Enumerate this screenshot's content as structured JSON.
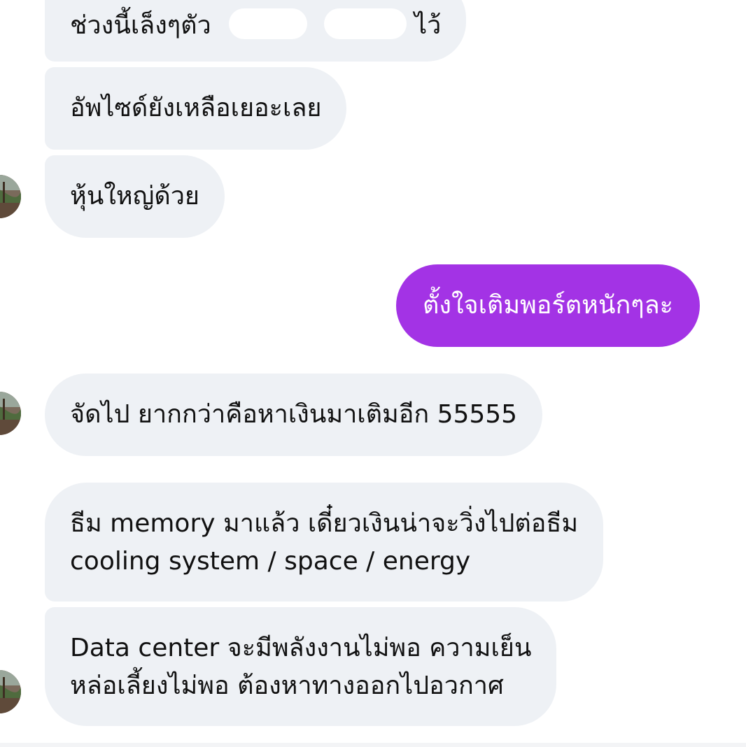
{
  "messages": [
    {
      "id": "b1",
      "direction": "incoming",
      "lines": [
        "ช่วงนี้เล็งๆตัว",
        "ไว้"
      ]
    },
    {
      "id": "b2",
      "direction": "incoming",
      "lines": [
        "อัพไซด์ยังเหลือเยอะเลย"
      ]
    },
    {
      "id": "b3",
      "direction": "incoming",
      "lines": [
        "หุ้นใหญ่ด้วย"
      ]
    },
    {
      "id": "b4",
      "direction": "outgoing",
      "lines": [
        "ตั้งใจเติมพอร์ตหนักๆละ"
      ]
    },
    {
      "id": "b5",
      "direction": "incoming",
      "lines": [
        "จัดไป ยากกว่าคือหาเงินมาเติมอีก 55555"
      ]
    },
    {
      "id": "b6",
      "direction": "incoming",
      "lines": [
        "ธีม memory มาแล้ว เดี๋ยวเงินน่าจะวิ่งไปต่อธีม",
        "cooling system / space / energy"
      ]
    },
    {
      "id": "b7",
      "direction": "incoming",
      "lines": [
        "Data center จะมีพลังงานไม่พอ ความเย็น",
        "หล่อเลี้ยงไม่พอ ต้องหาทางออกไปอวกาศ"
      ]
    }
  ],
  "colors": {
    "incoming_bubble": "#eef1f5",
    "outgoing_bubble": "#a333e5",
    "incoming_text": "#111111",
    "outgoing_text": "#ffffff"
  },
  "icons": [
    "avatar-photo"
  ]
}
